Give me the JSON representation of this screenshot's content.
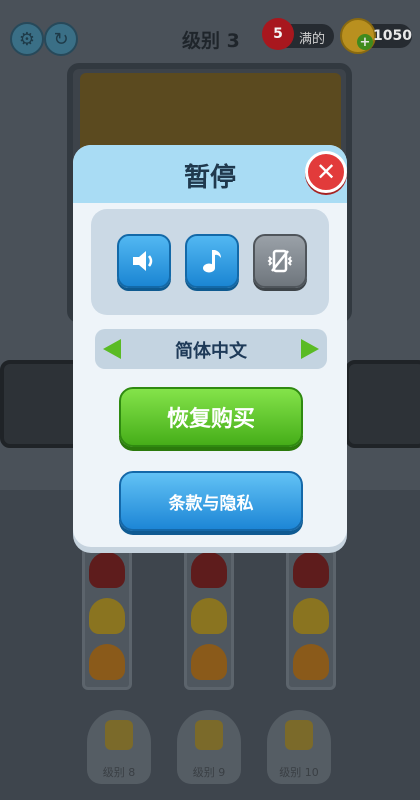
{
  "hud": {
    "level_title": "级别 3",
    "lives_count": "5",
    "lives_status": "满的",
    "coins": "1050"
  },
  "locked_levels": [
    "级别 8",
    "级别 9",
    "级别 10"
  ],
  "pause_dialog": {
    "title": "暂停",
    "language": "简体中文",
    "restore_purchase_label": "恢复购买",
    "terms_privacy_label": "条款与隐私"
  },
  "colors": {
    "accent_blue": "#1b86d3",
    "accent_green": "#46ae19",
    "close_red": "#e23b3b",
    "header_blue": "#a9dcf4"
  }
}
